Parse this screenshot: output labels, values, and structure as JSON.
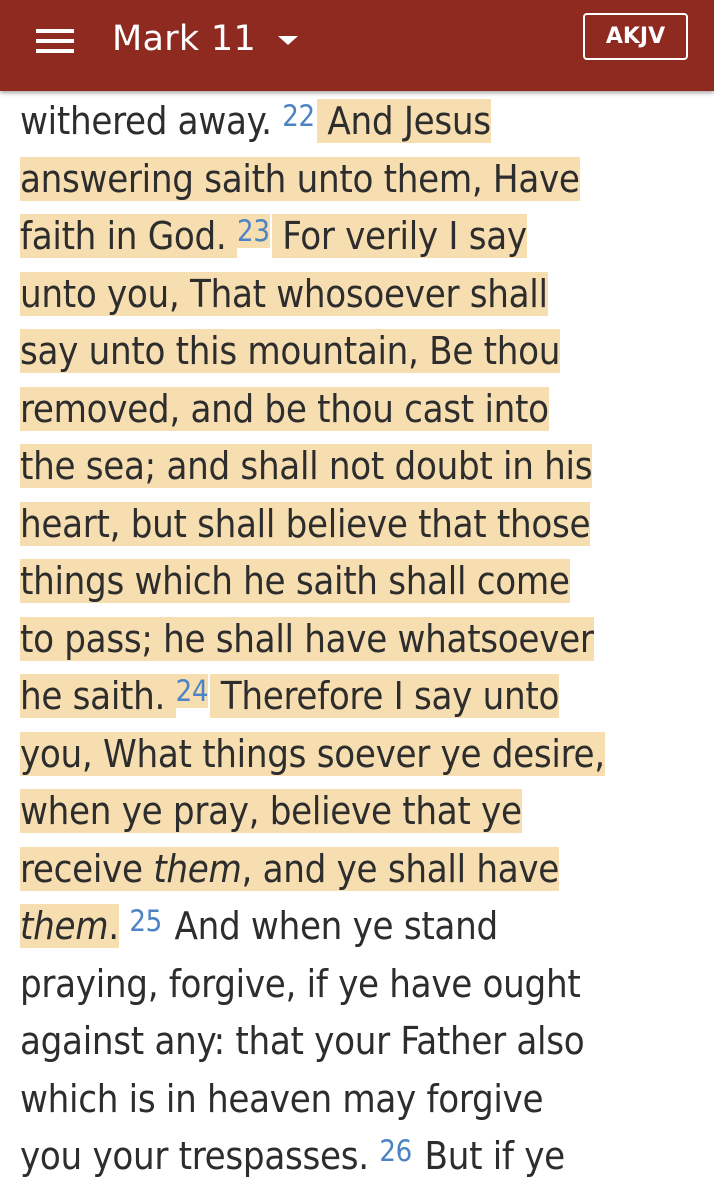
{
  "header": {
    "chapter": "Mark 11",
    "version": "AKJV"
  },
  "passage": {
    "lines": [
      {
        "segments": [
          {
            "text": "withered away. "
          },
          {
            "verse": "22"
          },
          {
            "text": " And Jesus",
            "hl": true
          }
        ]
      },
      {
        "segments": [
          {
            "text": "answering saith unto them, Have",
            "hl": true
          }
        ]
      },
      {
        "segments": [
          {
            "text": "faith in God. ",
            "hl": true
          },
          {
            "verse": "23",
            "hl": true
          },
          {
            "text": " For verily I say",
            "hl": true
          }
        ]
      },
      {
        "segments": [
          {
            "text": "unto you, That whosoever shall",
            "hl": true
          }
        ]
      },
      {
        "segments": [
          {
            "text": "say unto this mountain, Be thou",
            "hl": true
          }
        ]
      },
      {
        "segments": [
          {
            "text": "removed, and be thou cast into",
            "hl": true
          }
        ]
      },
      {
        "segments": [
          {
            "text": "the sea; and shall not doubt in his",
            "hl": true
          }
        ]
      },
      {
        "segments": [
          {
            "text": "heart, but shall believe that those",
            "hl": true
          }
        ]
      },
      {
        "segments": [
          {
            "text": "things which he saith shall come",
            "hl": true
          }
        ]
      },
      {
        "segments": [
          {
            "text": "to pass; he shall have whatsoever",
            "hl": true
          }
        ]
      },
      {
        "segments": [
          {
            "text": "he saith. ",
            "hl": true
          },
          {
            "verse": "24",
            "hl": true
          },
          {
            "text": " Therefore I say unto",
            "hl": true
          }
        ]
      },
      {
        "segments": [
          {
            "text": "you, What things soever ye desire,",
            "hl": true
          }
        ]
      },
      {
        "segments": [
          {
            "text": "when ye pray, believe that ye",
            "hl": true
          }
        ]
      },
      {
        "segments": [
          {
            "text": "receive ",
            "hl": true
          },
          {
            "text": "them",
            "italic": true,
            "hl": true
          },
          {
            "text": ", and ye shall have",
            "hl": true
          }
        ]
      },
      {
        "segments": [
          {
            "text": "them",
            "italic": true,
            "hl": true
          },
          {
            "text": ".",
            "hl": true
          },
          {
            "text": " "
          },
          {
            "verse": "25"
          },
          {
            "text": " And when ye stand"
          }
        ]
      },
      {
        "segments": [
          {
            "text": "praying, forgive, if ye have ought"
          }
        ]
      },
      {
        "segments": [
          {
            "text": "against any: that your Father also"
          }
        ]
      },
      {
        "segments": [
          {
            "text": "which is in heaven may forgive"
          }
        ]
      },
      {
        "segments": [
          {
            "text": "you your trespasses. "
          },
          {
            "verse": "26"
          },
          {
            "text": " But if ye"
          }
        ]
      }
    ]
  },
  "colors": {
    "appbar": "#8f2a20",
    "highlight": "#f7deb0",
    "verse_number": "#4c83c4",
    "text": "#2d2d2d"
  },
  "icons": {
    "menu": "hamburger-menu-icon",
    "dropdown": "caret-down-icon"
  }
}
